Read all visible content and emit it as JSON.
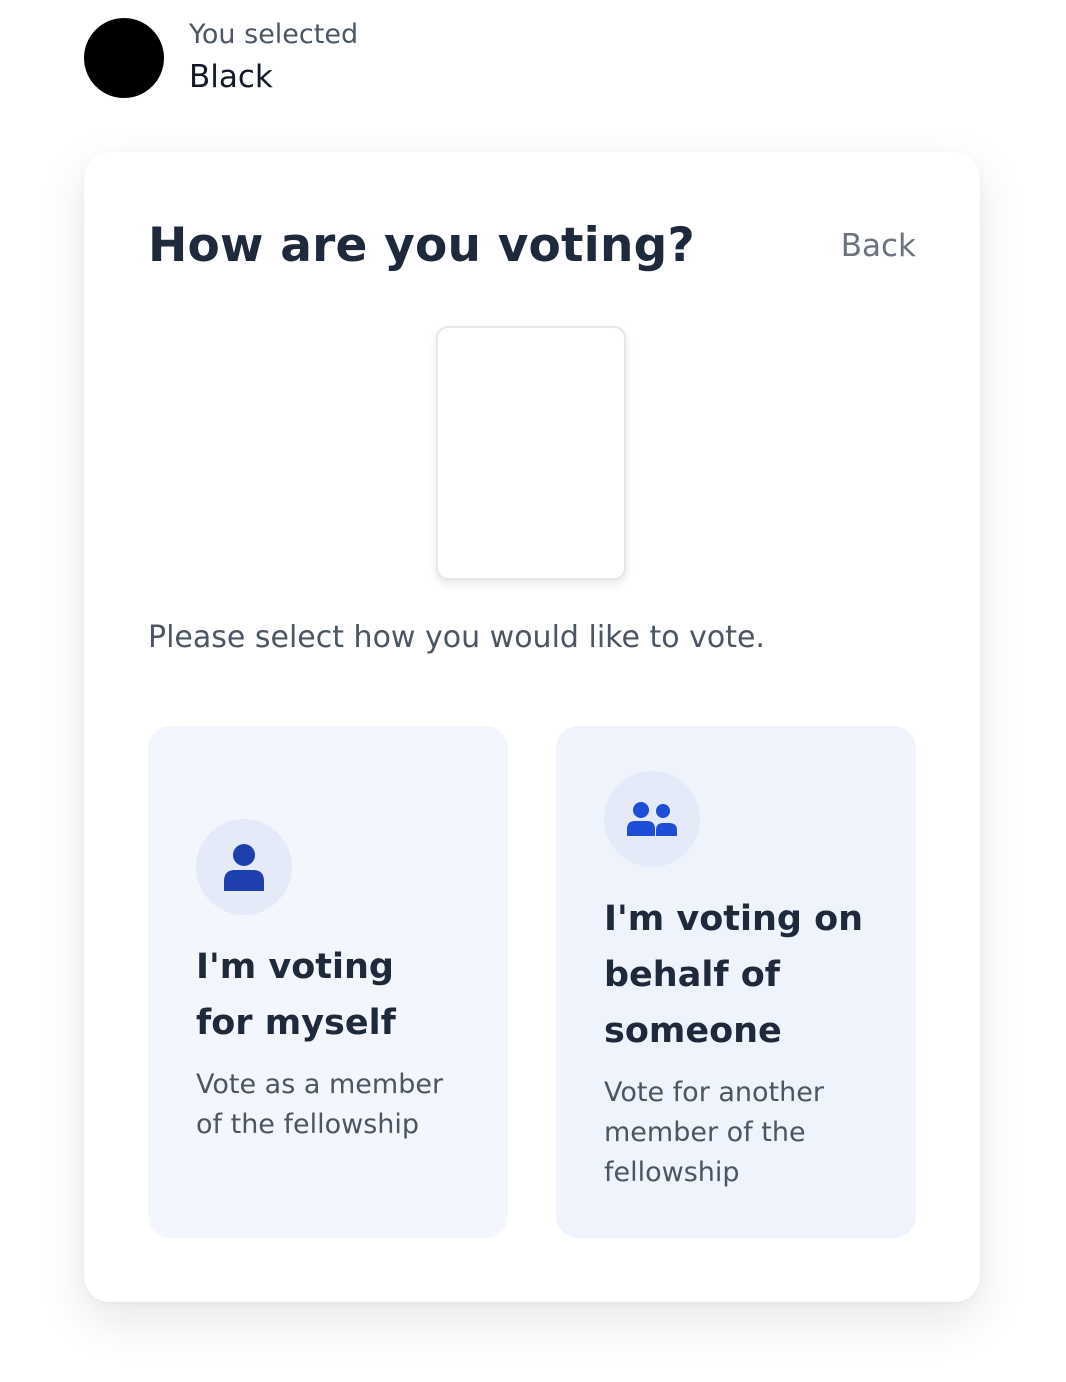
{
  "selection": {
    "caption": "You selected",
    "value": "Black",
    "swatch_color": "#000000"
  },
  "card": {
    "title": "How are you voting?",
    "back_label": "Back",
    "instruction": "Please select how you would like to vote."
  },
  "options": [
    {
      "icon": "user-icon",
      "title": "I'm voting for myself",
      "description": "Vote as a member of the fellowship"
    },
    {
      "icon": "users-icon",
      "title": "I'm voting on behalf of someone",
      "description": "Vote for another member of the fellowship"
    }
  ],
  "colors": {
    "accent": "#1e40af",
    "icon_secondary": "#1d4ed8",
    "tile_background": "#f3f6fd",
    "icon_background": "#e4eaf8"
  }
}
